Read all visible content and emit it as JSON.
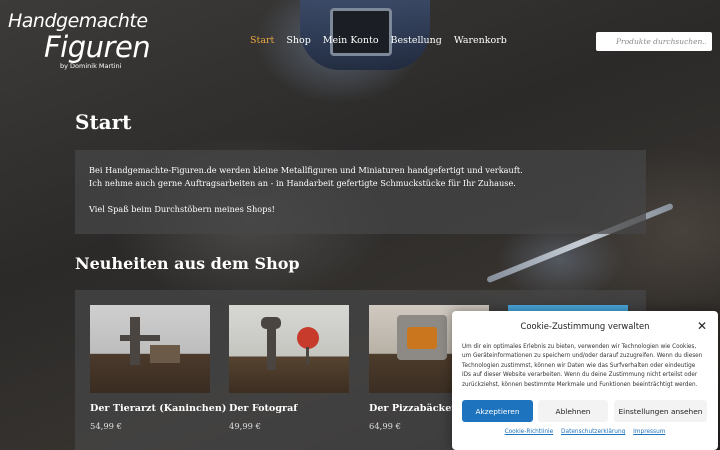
{
  "header": {
    "logo_line1": "Handgemachte",
    "logo_line2": "Figuren",
    "logo_line3": "by Dominik Martini",
    "nav": [
      "Start",
      "Shop",
      "Mein Konto",
      "Bestellung",
      "Warenkorb"
    ],
    "active_nav": "Start",
    "search_placeholder": "Produkte durchsuchen..."
  },
  "main": {
    "title": "Start",
    "intro_line1": "Bei Handgemachte-Figuren.de  werden kleine Metallfiguren und Miniaturen handgefertigt und verkauft.",
    "intro_line2": "Ich nehme auch gerne Auftragsarbeiten an - in Handarbeit gefertigte Schmuckstücke für Ihr Zuhause.",
    "intro_line3": "Viel Spaß beim Durchstöbern meines Shops!",
    "section_title": "Neuheiten aus dem Shop",
    "products": [
      {
        "name": "Der Tierarzt (Kaninchen)",
        "price": "54,99 €"
      },
      {
        "name": "Der Fotograf",
        "price": "49,99 €"
      },
      {
        "name": "Der Pizzabäcker",
        "price": "64,99 €"
      }
    ]
  },
  "cookie": {
    "title": "Cookie-Zustimmung verwalten",
    "text": "Um dir ein optimales Erlebnis zu bieten, verwenden wir Technologien wie Cookies, um Geräteinformationen zu speichern und/oder darauf zuzugreifen. Wenn du diesen Technologien zustimmst, können wir Daten wie das Surfverhalten oder eindeutige IDs auf dieser Website verarbeiten. Wenn du deine Zustimmung nicht erteilst oder zurückziehst, können bestimmte Merkmale und Funktionen beeinträchtigt werden.",
    "accept_label": "Akzeptieren",
    "decline_label": "Ablehnen",
    "settings_label": "Einstellungen ansehen",
    "links": [
      "Cookie-Richtlinie",
      "Datenschutzerklärung",
      "Impressum"
    ],
    "accent_color": "#1e73be"
  },
  "colors": {
    "nav_active": "#e8a640"
  }
}
